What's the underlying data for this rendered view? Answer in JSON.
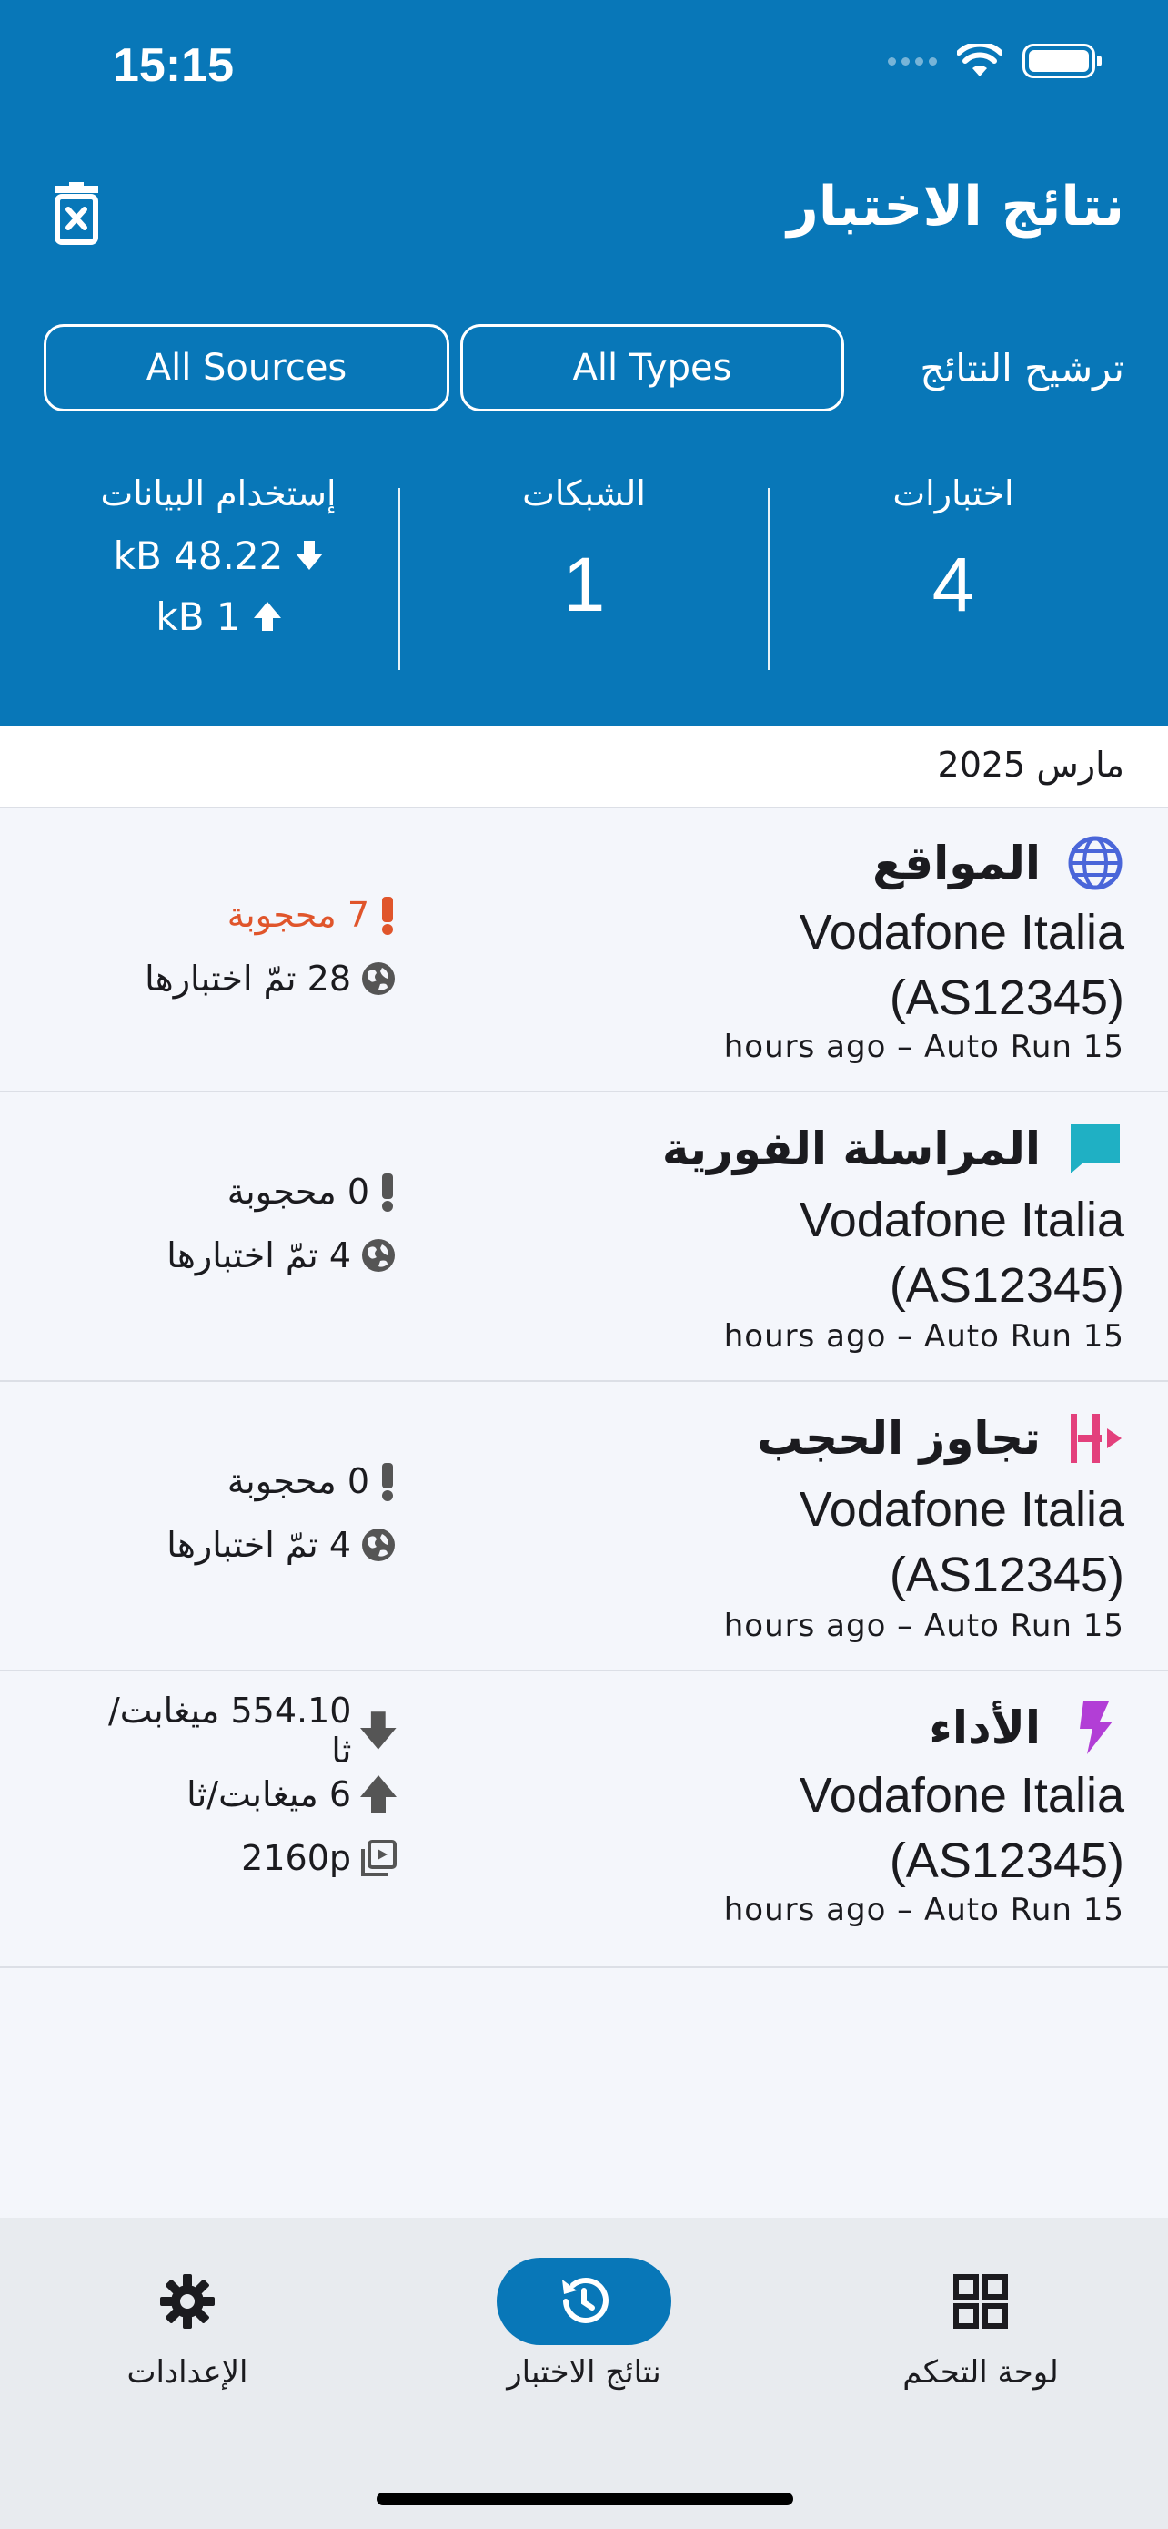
{
  "status_bar": {
    "time": "15:15"
  },
  "header": {
    "title": "نتائج الاختبار",
    "filter_label": "ترشيح النتائج",
    "filter_types": "All Types",
    "filter_sources": "All Sources"
  },
  "stats": {
    "tests_label": "اختبارات",
    "tests_value": "4",
    "networks_label": "الشبكات",
    "networks_value": "1",
    "usage_label": "إستخدام البيانات",
    "download": "kB 48.22",
    "upload": "kB 1"
  },
  "month": "مارس 2025",
  "results": [
    {
      "title": "المواقع",
      "icon": "globe-icon",
      "network_line1": "Vodafone Italia",
      "network_line2": "(AS12345)",
      "meta": "hours ago – Auto Run 15",
      "blocked": "7 محجوبة",
      "tested": "28 تمّ اختبارها"
    },
    {
      "title": "المراسلة الفورية",
      "icon": "chat-icon",
      "network_line1": "Vodafone Italia",
      "network_line2": "(AS12345)",
      "meta": "hours ago – Auto Run 15",
      "blocked": "0 محجوبة",
      "tested": "4 تمّ اختبارها"
    },
    {
      "title": "تجاوز الحجب",
      "icon": "circumvention-icon",
      "network_line1": "Vodafone Italia",
      "network_line2": "(AS12345)",
      "meta": "hours ago – Auto Run 15",
      "blocked": "0 محجوبة",
      "tested": "4 تمّ اختبارها"
    },
    {
      "title": "الأداء",
      "icon": "lightning-icon",
      "network_line1": "Vodafone Italia",
      "network_line2": "(AS12345)",
      "meta": "hours ago – Auto Run 15",
      "download": "554.10 ميغابت/ثا",
      "upload": "6 ميغابت/ثا",
      "video": "2160p"
    }
  ],
  "tabs": [
    {
      "label": "الإعدادات",
      "icon": "gear-icon"
    },
    {
      "label": "نتائج الاختبار",
      "icon": "history-icon"
    },
    {
      "label": "لوحة التحكم",
      "icon": "dashboard-icon"
    }
  ],
  "colors": {
    "header_bg": "#0877b8",
    "websites": "#4a66d9",
    "messaging": "#1fb0c4",
    "circumvention": "#e3407c",
    "performance": "#b23ed6",
    "blocked": "#e0552b"
  }
}
